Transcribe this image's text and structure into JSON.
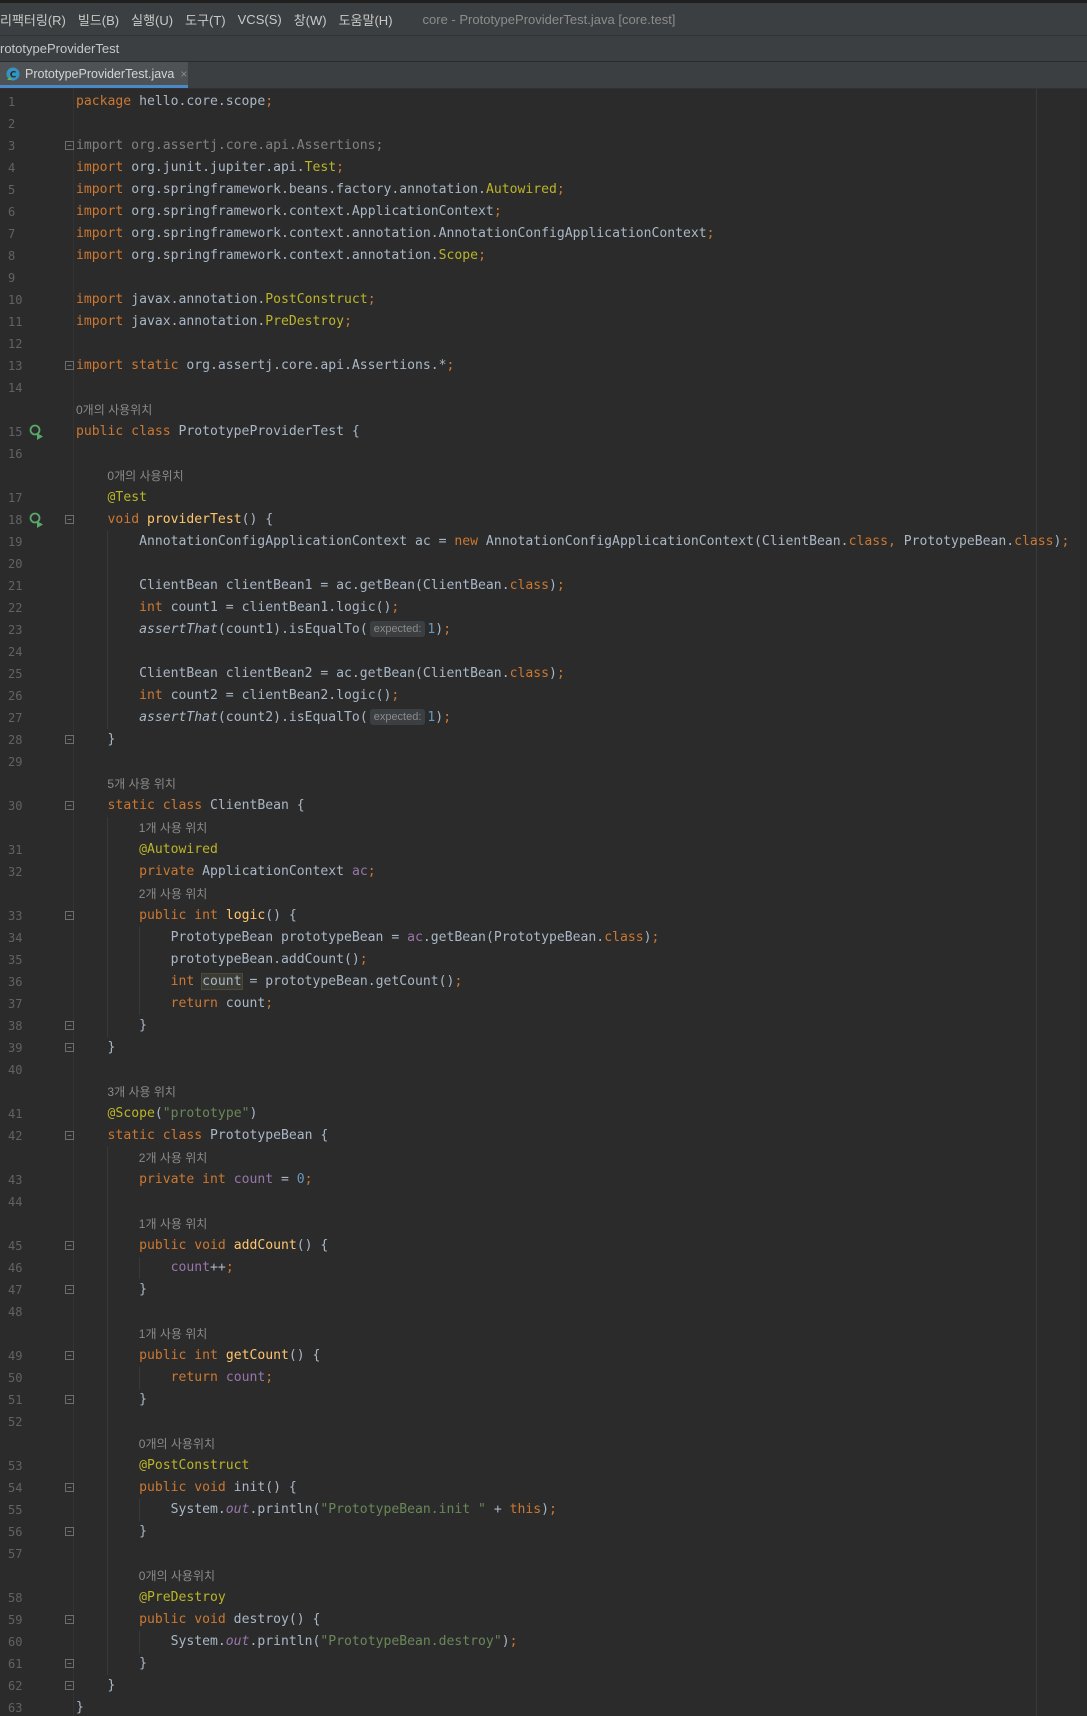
{
  "menu": [
    "리팩터링(R)",
    "빌드(B)",
    "실행(U)",
    "도구(T)",
    "VCS(S)",
    "창(W)",
    "도움말(H)"
  ],
  "window_title": "core - PrototypeProviderTest.java [core.test]",
  "breadcrumb": "rototypeProviderTest",
  "tab": {
    "label": "PrototypeProviderTest.java",
    "close": "×"
  },
  "hints": {
    "h15": "0개의 사용위치",
    "h17": "0개의 사용위치",
    "h30": "5개 사용 위치",
    "h31": "1개 사용 위치",
    "h33": "2개 사용 위치",
    "h41": "3개 사용 위치",
    "h43": "2개 사용 위치",
    "h45": "1개 사용 위치",
    "h49": "1개 사용 위치",
    "h53": "0개의 사용위치",
    "h58": "0개의 사용위치"
  },
  "param_hint": "expected:",
  "code": {
    "l1": [
      {
        "c": "kw",
        "t": "package"
      },
      {
        "t": " hello.core.scope"
      },
      {
        "c": "kw",
        "t": ";"
      }
    ],
    "l2": [],
    "l3": [
      {
        "c": "gray",
        "t": "import org.assertj.core.api.Assertions;"
      }
    ],
    "l4": [
      {
        "c": "kw",
        "t": "import"
      },
      {
        "t": " org.junit.jupiter.api."
      },
      {
        "c": "an",
        "t": "Test"
      },
      {
        "c": "kw",
        "t": ";"
      }
    ],
    "l5": [
      {
        "c": "kw",
        "t": "import"
      },
      {
        "t": " org.springframework.beans.factory.annotation."
      },
      {
        "c": "an",
        "t": "Autowired"
      },
      {
        "c": "kw",
        "t": ";"
      }
    ],
    "l6": [
      {
        "c": "kw",
        "t": "import"
      },
      {
        "t": " org.springframework.context.ApplicationContext"
      },
      {
        "c": "kw",
        "t": ";"
      }
    ],
    "l7": [
      {
        "c": "kw",
        "t": "import"
      },
      {
        "t": " org.springframework.context.annotation.AnnotationConfigApplicationContext"
      },
      {
        "c": "kw",
        "t": ";"
      }
    ],
    "l8": [
      {
        "c": "kw",
        "t": "import"
      },
      {
        "t": " org.springframework.context.annotation."
      },
      {
        "c": "an",
        "t": "Scope"
      },
      {
        "c": "kw",
        "t": ";"
      }
    ],
    "l9": [],
    "l10": [
      {
        "c": "kw",
        "t": "import"
      },
      {
        "t": " javax.annotation."
      },
      {
        "c": "an",
        "t": "PostConstruct"
      },
      {
        "c": "kw",
        "t": ";"
      }
    ],
    "l11": [
      {
        "c": "kw",
        "t": "import"
      },
      {
        "t": " javax.annotation."
      },
      {
        "c": "an",
        "t": "PreDestroy"
      },
      {
        "c": "kw",
        "t": ";"
      }
    ],
    "l12": [],
    "l13": [
      {
        "c": "kw",
        "t": "import static"
      },
      {
        "t": " org.assertj.core.api.Assertions.*"
      },
      {
        "c": "kw",
        "t": ";"
      }
    ],
    "l14": [],
    "l15": [
      {
        "c": "kw",
        "t": "public class"
      },
      {
        "t": " PrototypeProviderTest {"
      }
    ],
    "l16": [],
    "l17": [
      {
        "t": "    "
      },
      {
        "c": "an",
        "t": "@Test"
      }
    ],
    "l18": [
      {
        "t": "    "
      },
      {
        "c": "kw",
        "t": "void"
      },
      {
        "t": " "
      },
      {
        "c": "fn",
        "t": "providerTest"
      },
      {
        "t": "() {"
      }
    ],
    "l19": [
      {
        "t": "        AnnotationConfigApplicationContext ac = "
      },
      {
        "c": "kw",
        "t": "new"
      },
      {
        "t": " AnnotationConfigApplicationContext(ClientBean."
      },
      {
        "c": "kw",
        "t": "class"
      },
      {
        "c": "kw",
        "t": ","
      },
      {
        "t": " PrototypeBean."
      },
      {
        "c": "kw",
        "t": "class"
      },
      {
        "t": ")"
      },
      {
        "c": "kw",
        "t": ";"
      }
    ],
    "l20": [],
    "l21": [
      {
        "t": "        ClientBean clientBean1 = ac.getBean(ClientBean."
      },
      {
        "c": "kw",
        "t": "class"
      },
      {
        "t": ")"
      },
      {
        "c": "kw",
        "t": ";"
      }
    ],
    "l22": [
      {
        "t": "        "
      },
      {
        "c": "kw",
        "t": "int"
      },
      {
        "t": " count1 = clientBean1.logic()"
      },
      {
        "c": "kw",
        "t": ";"
      }
    ],
    "l23": [
      {
        "t": "        "
      },
      {
        "c": "it",
        "t": "assertThat"
      },
      {
        "t": "(count1).isEqualTo("
      },
      {
        "c": "ph",
        "t": "expected:"
      },
      {
        "c": "nu",
        "t": "1"
      },
      {
        "t": ")"
      },
      {
        "c": "kw",
        "t": ";"
      }
    ],
    "l24": [],
    "l25": [
      {
        "t": "        ClientBean clientBean2 = ac.getBean(ClientBean."
      },
      {
        "c": "kw",
        "t": "class"
      },
      {
        "t": ")"
      },
      {
        "c": "kw",
        "t": ";"
      }
    ],
    "l26": [
      {
        "t": "        "
      },
      {
        "c": "kw",
        "t": "int"
      },
      {
        "t": " count2 = clientBean2.logic()"
      },
      {
        "c": "kw",
        "t": ";"
      }
    ],
    "l27": [
      {
        "t": "        "
      },
      {
        "c": "it",
        "t": "assertThat"
      },
      {
        "t": "(count2).isEqualTo("
      },
      {
        "c": "ph",
        "t": "expected:"
      },
      {
        "c": "nu",
        "t": "1"
      },
      {
        "t": ")"
      },
      {
        "c": "kw",
        "t": ";"
      }
    ],
    "l28": [
      {
        "t": "    }"
      }
    ],
    "l29": [],
    "l30": [
      {
        "t": "    "
      },
      {
        "c": "kw",
        "t": "static class"
      },
      {
        "t": " ClientBean {"
      }
    ],
    "l31": [
      {
        "t": "        "
      },
      {
        "c": "an",
        "t": "@Autowired"
      }
    ],
    "l32": [
      {
        "t": "        "
      },
      {
        "c": "kw",
        "t": "private"
      },
      {
        "t": " ApplicationContext "
      },
      {
        "c": "fld",
        "t": "ac"
      },
      {
        "c": "kw",
        "t": ";"
      }
    ],
    "l33": [
      {
        "t": "        "
      },
      {
        "c": "kw",
        "t": "public int"
      },
      {
        "t": " "
      },
      {
        "c": "fn",
        "t": "logic"
      },
      {
        "t": "() {"
      }
    ],
    "l34": [
      {
        "t": "            PrototypeBean prototypeBean = "
      },
      {
        "c": "fld",
        "t": "ac"
      },
      {
        "t": ".getBean(PrototypeBean."
      },
      {
        "c": "kw",
        "t": "class"
      },
      {
        "t": ")"
      },
      {
        "c": "kw",
        "t": ";"
      }
    ],
    "l35": [
      {
        "t": "            prototypeBean.addCount()"
      },
      {
        "c": "kw",
        "t": ";"
      }
    ],
    "l36": [
      {
        "t": "            "
      },
      {
        "c": "kw",
        "t": "int"
      },
      {
        "t": " "
      },
      {
        "c": "hl",
        "t": "count"
      },
      {
        "t": " = prototypeBean.getCount()"
      },
      {
        "c": "kw",
        "t": ";"
      }
    ],
    "l37": [
      {
        "t": "            "
      },
      {
        "c": "kw",
        "t": "return"
      },
      {
        "t": " count"
      },
      {
        "c": "kw",
        "t": ";"
      }
    ],
    "l38": [
      {
        "t": "        }"
      }
    ],
    "l39": [
      {
        "t": "    }"
      }
    ],
    "l40": [],
    "l41": [
      {
        "t": "    "
      },
      {
        "c": "an",
        "t": "@Scope"
      },
      {
        "t": "("
      },
      {
        "c": "st",
        "t": "\"prototype\""
      },
      {
        "t": ")"
      }
    ],
    "l42": [
      {
        "t": "    "
      },
      {
        "c": "kw",
        "t": "static class"
      },
      {
        "t": " PrototypeBean {"
      }
    ],
    "l43": [
      {
        "t": "        "
      },
      {
        "c": "kw",
        "t": "private int"
      },
      {
        "t": " "
      },
      {
        "c": "fld",
        "t": "count"
      },
      {
        "t": " = "
      },
      {
        "c": "nu",
        "t": "0"
      },
      {
        "c": "kw",
        "t": ";"
      }
    ],
    "l44": [],
    "l45": [
      {
        "t": "        "
      },
      {
        "c": "kw",
        "t": "public void"
      },
      {
        "t": " "
      },
      {
        "c": "fn",
        "t": "addCount"
      },
      {
        "t": "() {"
      }
    ],
    "l46": [
      {
        "t": "            "
      },
      {
        "c": "fld",
        "t": "count"
      },
      {
        "t": "++"
      },
      {
        "c": "kw",
        "t": ";"
      }
    ],
    "l47": [
      {
        "t": "        }"
      }
    ],
    "l48": [],
    "l49": [
      {
        "t": "        "
      },
      {
        "c": "kw",
        "t": "public int"
      },
      {
        "t": " "
      },
      {
        "c": "fn",
        "t": "getCount"
      },
      {
        "t": "() {"
      }
    ],
    "l50": [
      {
        "t": "            "
      },
      {
        "c": "kw",
        "t": "return"
      },
      {
        "t": " "
      },
      {
        "c": "fld",
        "t": "count"
      },
      {
        "c": "kw",
        "t": ";"
      }
    ],
    "l51": [
      {
        "t": "        }"
      }
    ],
    "l52": [],
    "l53": [
      {
        "t": "        "
      },
      {
        "c": "an",
        "t": "@PostConstruct"
      }
    ],
    "l54": [
      {
        "t": "        "
      },
      {
        "c": "kw",
        "t": "public void"
      },
      {
        "t": " init() {"
      }
    ],
    "l55": [
      {
        "t": "            System."
      },
      {
        "c": "fld it",
        "t": "out"
      },
      {
        "t": ".println("
      },
      {
        "c": "st",
        "t": "\"PrototypeBean.init \""
      },
      {
        "t": " + "
      },
      {
        "c": "kw",
        "t": "this"
      },
      {
        "t": ")"
      },
      {
        "c": "kw",
        "t": ";"
      }
    ],
    "l56": [
      {
        "t": "        }"
      }
    ],
    "l57": [],
    "l58": [
      {
        "t": "        "
      },
      {
        "c": "an",
        "t": "@PreDestroy"
      }
    ],
    "l59": [
      {
        "t": "        "
      },
      {
        "c": "kw",
        "t": "public void"
      },
      {
        "t": " destroy() {"
      }
    ],
    "l60": [
      {
        "t": "            System."
      },
      {
        "c": "fld it",
        "t": "out"
      },
      {
        "t": ".println("
      },
      {
        "c": "st",
        "t": "\"PrototypeBean.destroy\""
      },
      {
        "t": ")"
      },
      {
        "c": "kw",
        "t": ";"
      }
    ],
    "l61": [
      {
        "t": "        }"
      }
    ],
    "l62": [
      {
        "t": "    }"
      }
    ],
    "l63": [
      {
        "t": "}"
      }
    ]
  },
  "line_numbers": [
    "1",
    "2",
    "3",
    "4",
    "5",
    "6",
    "7",
    "8",
    "9",
    "10",
    "11",
    "12",
    "13",
    "14",
    "15",
    "16",
    "17",
    "18",
    "19",
    "20",
    "21",
    "22",
    "23",
    "24",
    "25",
    "26",
    "27",
    "28",
    "29",
    "30",
    "31",
    "32",
    "33",
    "34",
    "35",
    "36",
    "37",
    "38",
    "39",
    "40",
    "41",
    "42",
    "43",
    "44",
    "45",
    "46",
    "47",
    "48",
    "49",
    "50",
    "51",
    "52",
    "53",
    "54",
    "55",
    "56",
    "57",
    "58",
    "59",
    "60",
    "61",
    "62",
    "63"
  ],
  "icons": {
    "run_gutter": "run-test-icon",
    "tab_file": "java-class-icon"
  },
  "colors": {
    "keyword": "#cc7832",
    "annotation": "#bbb529",
    "string": "#6a8759",
    "number": "#6897bb",
    "field": "#9876aa",
    "method": "#ffc66d",
    "text": "#a9b7c6",
    "background": "#2b2b2b"
  }
}
